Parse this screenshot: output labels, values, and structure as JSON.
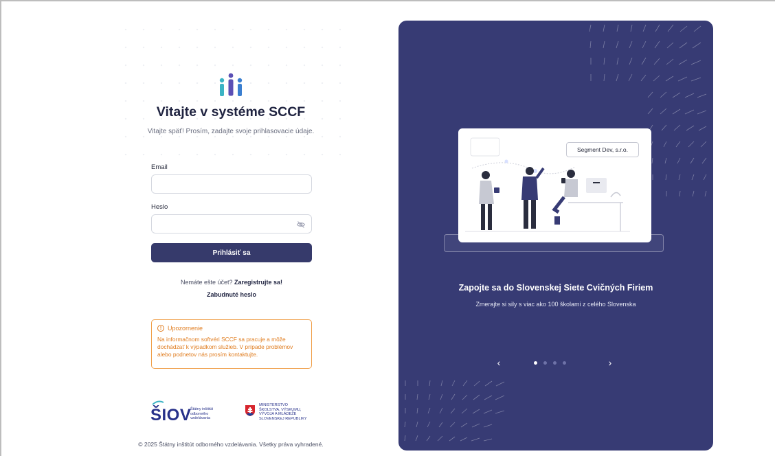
{
  "app": {
    "title": "Vitajte v systéme SCCF",
    "subtitle": "Vitajte späť! Prosím, zadajte svoje prihlasovacie údaje."
  },
  "form": {
    "email_label": "Email",
    "email_value": "",
    "email_placeholder": "",
    "password_label": "Heslo",
    "password_value": "",
    "password_placeholder": "",
    "submit_label": "Prihlásiť sa",
    "no_account_text": "Nemáte ešte účet?",
    "register_link": "Zaregistrujte sa!",
    "forgot_link": "Zabudnuté heslo"
  },
  "notice": {
    "title": "Upozornenie",
    "icon": "info-icon",
    "body": "Na informačnom softvéri SCCF sa pracuje a môže dochádzať k výpadkom služieb. V prípade problémov alebo podnetov nás prosím kontaktujte."
  },
  "logos": {
    "siov_name": "ŠIOV",
    "siov_sub_1": "Štátny inštitút",
    "siov_sub_2": "odborného",
    "siov_sub_3": "vzdelávania",
    "ministry_1": "MINISTERSTVO",
    "ministry_2": "ŠKOLSTVA, VÝSKUMU,",
    "ministry_3": "VÝVOJA A MLÁDEŽE",
    "ministry_4": "SLOVENSKEJ REPUBLIKY"
  },
  "footer": {
    "copyright": "© 2025 Štátny inštitút odborného vzdelávania. Všetky práva vyhradené."
  },
  "carousel": {
    "card_company": "Segment Dev, s.r.o.",
    "title": "Zapojte sa do Slovenskej Siete Cvičných Firiem",
    "subtitle": "Zmerajte si sily s viac ako 100 školami z celého Slovenska",
    "prev_icon": "chevron-left-icon",
    "next_icon": "chevron-right-icon",
    "slides_total": 4,
    "active_slide": 1
  },
  "colors": {
    "primary": "#363a6b",
    "panel": "#373b74",
    "warning": "#e07d20",
    "logo_teal": "#3bb3c4",
    "logo_blue": "#27318a"
  }
}
